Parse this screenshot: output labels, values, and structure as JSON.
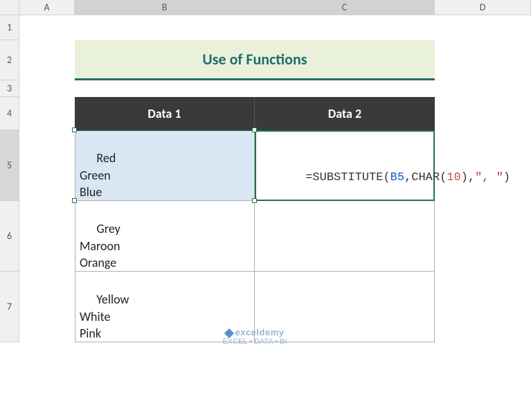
{
  "columns": {
    "A": "A",
    "B": "B",
    "C": "C",
    "D": "D"
  },
  "rows": {
    "r1": "1",
    "r2": "2",
    "r3": "3",
    "r4": "4",
    "r5": "5",
    "r6": "6",
    "r7": "7"
  },
  "title": "Use of Functions",
  "headers": {
    "data1": "Data 1",
    "data2": "Data 2"
  },
  "table": {
    "b5": "Red\nGreen\nBlue",
    "b6": "Grey\nMaroon\nOrange",
    "b7": "Yellow\nWhite\nPink"
  },
  "formula": {
    "prefix": "=",
    "fn1": "SUBSTITUTE",
    "open1": "(",
    "ref": "B5",
    "comma1": ",",
    "fn2": "CHAR",
    "open2": "(",
    "num": "10",
    "close2": ")",
    "comma2": ",",
    "str": "\", \"",
    "close1": ")"
  },
  "watermark": {
    "brand": "exceldemy",
    "tagline": "EXCEL • DATA • BI"
  },
  "chart_data": {
    "type": "table",
    "title": "Use of Functions",
    "columns": [
      "Data 1",
      "Data 2"
    ],
    "rows": [
      {
        "Data 1": "Red\nGreen\nBlue",
        "Data 2": "=SUBSTITUTE(B5,CHAR(10),\", \")"
      },
      {
        "Data 1": "Grey\nMaroon\nOrange",
        "Data 2": ""
      },
      {
        "Data 1": "Yellow\nWhite\nPink",
        "Data 2": ""
      }
    ]
  }
}
